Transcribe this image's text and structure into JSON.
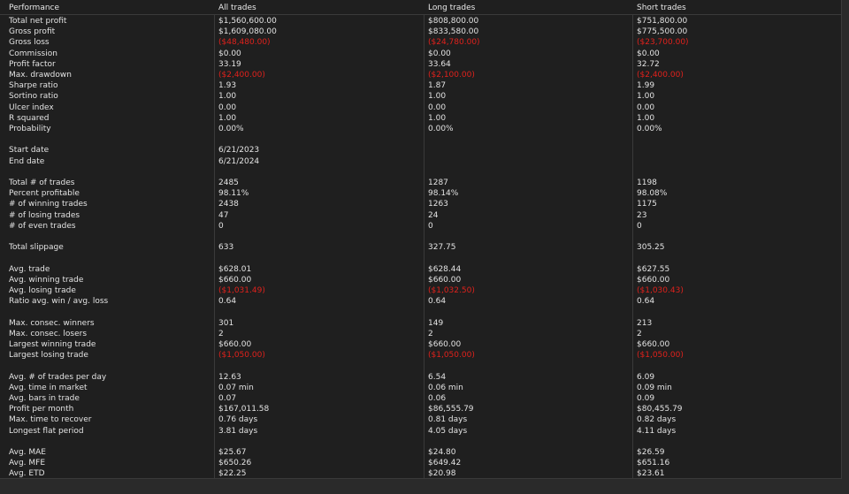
{
  "columns": [
    "Performance",
    "All trades",
    "Long trades",
    "Short trades"
  ],
  "rows": [
    {
      "label": "Total net profit",
      "all": "$1,560,600.00",
      "long": "$808,800.00",
      "short": "$751,800.00"
    },
    {
      "label": "Gross profit",
      "all": "$1,609,080.00",
      "long": "$833,580.00",
      "short": "$775,500.00"
    },
    {
      "label": "Gross loss",
      "all": "($48,480.00)",
      "long": "($24,780.00)",
      "short": "($23,700.00)",
      "negative": true
    },
    {
      "label": "Commission",
      "all": "$0.00",
      "long": "$0.00",
      "short": "$0.00"
    },
    {
      "label": "Profit factor",
      "all": "33.19",
      "long": "33.64",
      "short": "32.72"
    },
    {
      "label": "Max. drawdown",
      "all": "($2,400.00)",
      "long": "($2,100.00)",
      "short": "($2,400.00)",
      "negative": true
    },
    {
      "label": "Sharpe ratio",
      "all": "1.93",
      "long": "1.87",
      "short": "1.99"
    },
    {
      "label": "Sortino ratio",
      "all": "1.00",
      "long": "1.00",
      "short": "1.00"
    },
    {
      "label": "Ulcer index",
      "all": "0.00",
      "long": "0.00",
      "short": "0.00"
    },
    {
      "label": "R squared",
      "all": "1.00",
      "long": "1.00",
      "short": "1.00"
    },
    {
      "label": "Probability",
      "all": "0.00%",
      "long": "0.00%",
      "short": "0.00%"
    },
    {
      "label": "",
      "all": "",
      "long": "",
      "short": ""
    },
    {
      "label": "Start date",
      "all": "6/21/2023",
      "long": "",
      "short": ""
    },
    {
      "label": "End date",
      "all": "6/21/2024",
      "long": "",
      "short": ""
    },
    {
      "label": "",
      "all": "",
      "long": "",
      "short": ""
    },
    {
      "label": "Total # of trades",
      "all": "2485",
      "long": "1287",
      "short": "1198"
    },
    {
      "label": "Percent profitable",
      "all": "98.11%",
      "long": "98.14%",
      "short": "98.08%"
    },
    {
      "label": "# of winning trades",
      "all": "2438",
      "long": "1263",
      "short": "1175"
    },
    {
      "label": "# of losing trades",
      "all": "47",
      "long": "24",
      "short": "23"
    },
    {
      "label": "# of even trades",
      "all": "0",
      "long": "0",
      "short": "0"
    },
    {
      "label": "",
      "all": "",
      "long": "",
      "short": ""
    },
    {
      "label": "Total slippage",
      "all": "633",
      "long": "327.75",
      "short": "305.25"
    },
    {
      "label": "",
      "all": "",
      "long": "",
      "short": ""
    },
    {
      "label": "Avg. trade",
      "all": "$628.01",
      "long": "$628.44",
      "short": "$627.55"
    },
    {
      "label": "Avg. winning trade",
      "all": "$660.00",
      "long": "$660.00",
      "short": "$660.00"
    },
    {
      "label": "Avg. losing trade",
      "all": "($1,031.49)",
      "long": "($1,032.50)",
      "short": "($1,030.43)",
      "negative": true
    },
    {
      "label": "Ratio avg. win / avg. loss",
      "all": "0.64",
      "long": "0.64",
      "short": "0.64"
    },
    {
      "label": "",
      "all": "",
      "long": "",
      "short": ""
    },
    {
      "label": "Max. consec. winners",
      "all": "301",
      "long": "149",
      "short": "213"
    },
    {
      "label": "Max. consec. losers",
      "all": "2",
      "long": "2",
      "short": "2"
    },
    {
      "label": "Largest winning trade",
      "all": "$660.00",
      "long": "$660.00",
      "short": "$660.00"
    },
    {
      "label": "Largest losing trade",
      "all": "($1,050.00)",
      "long": "($1,050.00)",
      "short": "($1,050.00)",
      "negative": true
    },
    {
      "label": "",
      "all": "",
      "long": "",
      "short": ""
    },
    {
      "label": "Avg. # of trades per day",
      "all": "12.63",
      "long": "6.54",
      "short": "6.09"
    },
    {
      "label": "Avg. time in market",
      "all": "0.07 min",
      "long": "0.06 min",
      "short": "0.09 min"
    },
    {
      "label": "Avg. bars in trade",
      "all": "0.07",
      "long": "0.06",
      "short": "0.09"
    },
    {
      "label": "Profit per month",
      "all": "$167,011.58",
      "long": "$86,555.79",
      "short": "$80,455.79"
    },
    {
      "label": "Max. time to recover",
      "all": "0.76 days",
      "long": "0.81 days",
      "short": "0.82 days"
    },
    {
      "label": "Longest flat period",
      "all": "3.81 days",
      "long": "4.05 days",
      "short": "4.11 days"
    },
    {
      "label": "",
      "all": "",
      "long": "",
      "short": ""
    },
    {
      "label": "Avg. MAE",
      "all": "$25.67",
      "long": "$24.80",
      "short": "$26.59"
    },
    {
      "label": "Avg. MFE",
      "all": "$650.26",
      "long": "$649.42",
      "short": "$651.16"
    },
    {
      "label": "Avg. ETD",
      "all": "$22.25",
      "long": "$20.98",
      "short": "$23.61"
    }
  ],
  "colors": {
    "background": "#1f1f1f",
    "text": "#e3e3e3",
    "negative": "#e0211c",
    "grid": "#3a3a3a"
  }
}
